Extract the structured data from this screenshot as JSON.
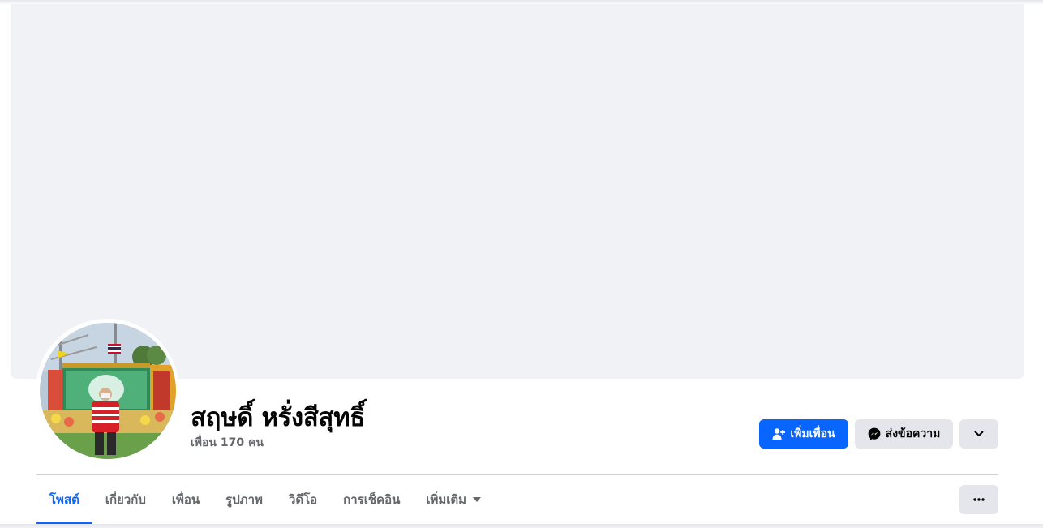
{
  "profile": {
    "name": "สฤษดิ์ หรั่งสีสุทธิ์",
    "friends_text": "เพื่อน 170 คน"
  },
  "actions": {
    "add_friend_label": "เพิ่มเพื่อน",
    "message_label": "ส่งข้อความ",
    "dropdown_icon": "chevron-down-icon"
  },
  "tabs": [
    {
      "label": "โพสต์",
      "active": true
    },
    {
      "label": "เกี่ยวกับ",
      "active": false
    },
    {
      "label": "เพื่อน",
      "active": false
    },
    {
      "label": "รูปภาพ",
      "active": false
    },
    {
      "label": "วิดีโอ",
      "active": false
    },
    {
      "label": "การเช็คอิน",
      "active": false
    },
    {
      "label": "เพิ่มเติม",
      "active": false
    }
  ],
  "colors": {
    "accent": "#0866ff",
    "cover": "#f0f2f5",
    "secondary_button": "#e4e6eb",
    "muted_text": "#65676b"
  }
}
